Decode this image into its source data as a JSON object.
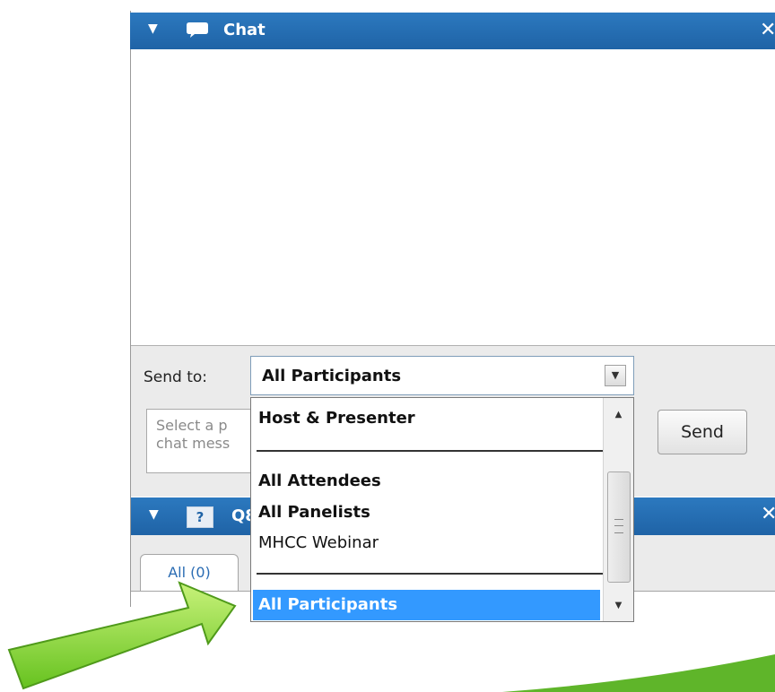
{
  "chat_panel": {
    "title": "Chat",
    "close_glyph": "✕",
    "collapse_glyph": "▼",
    "icon": "chat-bubble-icon",
    "send_to_label": "Send to:",
    "selected_recipient": "All Participants",
    "message_placeholder": "Select a p\nchat mess",
    "send_label": "Send"
  },
  "recipient_dropdown": {
    "options": [
      {
        "label": "Host & Presenter",
        "bold": true
      },
      {
        "label": "All Attendees",
        "bold": true
      },
      {
        "label": "All Panelists",
        "bold": true
      },
      {
        "label": "MHCC Webinar",
        "bold": false
      },
      {
        "label": "All Participants",
        "bold": true,
        "selected": true
      }
    ]
  },
  "qa_panel": {
    "title": "Q8",
    "icon_glyph": "?",
    "collapse_glyph": "▼",
    "close_glyph": "✕",
    "tabs": [
      {
        "label": "All (0)"
      }
    ]
  },
  "colors": {
    "header_blue": "#1f63a6",
    "selection_blue": "#3399ff",
    "arrow_green": "#8fdc3a"
  }
}
